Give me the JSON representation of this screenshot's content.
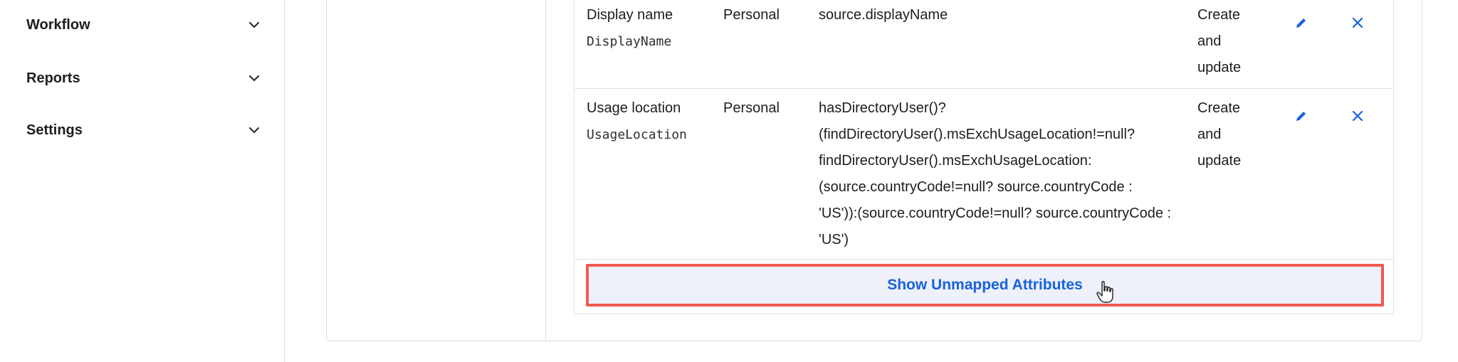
{
  "sidebar": {
    "items": [
      {
        "label": "Workflow",
        "icon": "chevron-down-icon"
      },
      {
        "label": "Reports",
        "icon": "chevron-down-icon"
      },
      {
        "label": "Settings",
        "icon": "chevron-down-icon"
      }
    ]
  },
  "mappings": {
    "rows": [
      {
        "attribute_label": "Display name",
        "attribute_variable": "DisplayName",
        "type": "Personal",
        "expression": "source.displayName",
        "apply_on": "Create and update"
      },
      {
        "attribute_label": "Usage location",
        "attribute_variable": "UsageLocation",
        "type": "Personal",
        "expression": "hasDirectoryUser()?(findDirectoryUser().msExchUsageLocation!=null?findDirectoryUser().msExchUsageLocation:(source.countryCode!=null? source.countryCode : 'US')):(source.countryCode!=null? source.countryCode : 'US')",
        "apply_on": "Create and update"
      }
    ],
    "show_unmapped_label": "Show Unmapped Attributes"
  },
  "colors": {
    "accent": "#1662dd",
    "highlight_border": "#ee5a52",
    "button_bg": "#eef0fa"
  }
}
